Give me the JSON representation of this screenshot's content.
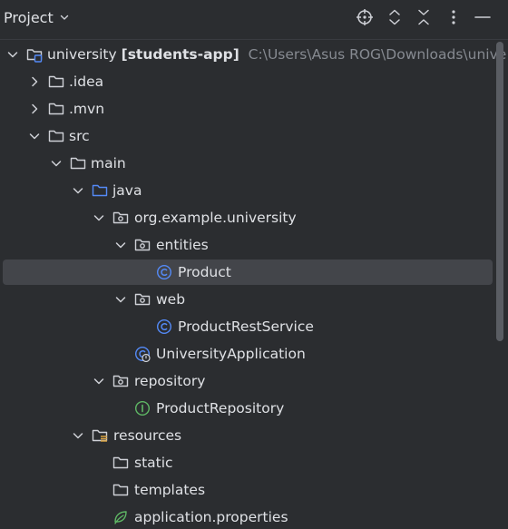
{
  "panel": {
    "title": "Project"
  },
  "toolbar": {
    "icons": [
      "crosshair-icon",
      "expand-all-icon",
      "collapse-all-icon",
      "more-options-icon",
      "minimize-icon"
    ]
  },
  "tree": {
    "root": {
      "name": "university",
      "module": "[students-app]",
      "path": "C:\\Users\\Asus ROG\\Downloads\\unive"
    },
    "idea": ".idea",
    "mvn": ".mvn",
    "src": "src",
    "main": "main",
    "java": "java",
    "pkg": "org.example.university",
    "entities": "entities",
    "product": "Product",
    "web": "web",
    "product_rest_service": "ProductRestService",
    "university_application": "UniversityApplication",
    "repository": "repository",
    "product_repository": "ProductRepository",
    "resources": "resources",
    "static": "static",
    "templates": "templates",
    "application_properties": "application.properties"
  },
  "colors": {
    "background": "#2b2d30",
    "selection": "#43454a",
    "text": "#dfe1e5",
    "path_text": "#868a91",
    "source_folder_blue": "#548af7",
    "class_icon_blue": "#548af7",
    "interface_icon_green": "#5fb865",
    "spring_icon_green": "#5fb865"
  }
}
